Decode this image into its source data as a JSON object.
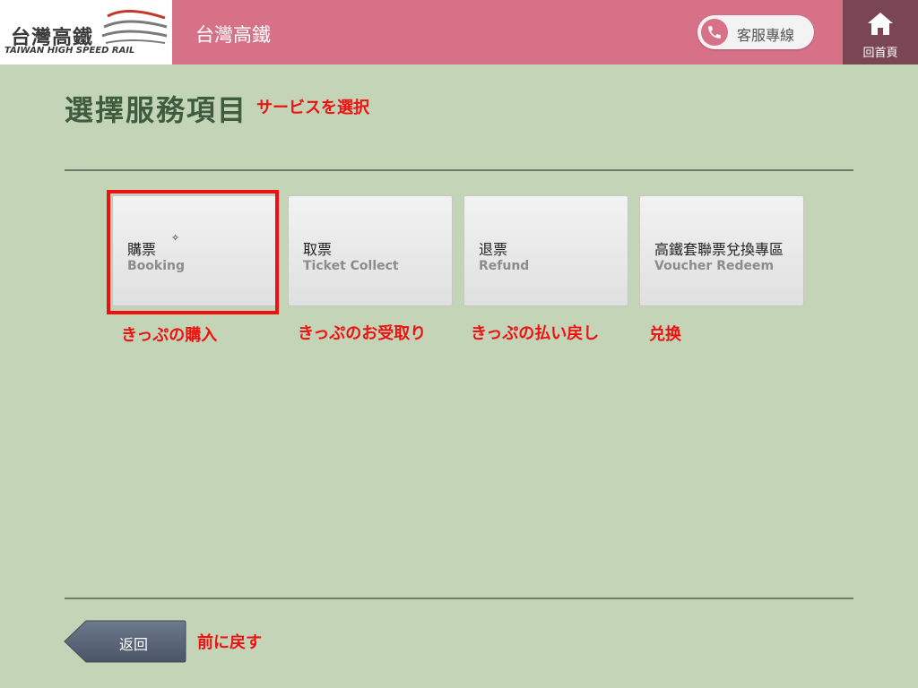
{
  "header": {
    "logo_title": "台灣高鐵",
    "logo_subtitle": "TAIWAN HIGH SPEED RAIL",
    "title": "台灣高鐵",
    "service_label": "客服專線",
    "home_label": "回首頁",
    "colors": {
      "bar": "#d77187",
      "home": "#7a4654"
    }
  },
  "main": {
    "title": "選擇服務項目",
    "title_note": "サービスを選択",
    "tiles": [
      {
        "title": "購票",
        "subtitle": "Booking",
        "note": "きっぷの購入"
      },
      {
        "title": "取票",
        "subtitle": "Ticket Collect",
        "note": "きっぷのお受取り"
      },
      {
        "title": "退票",
        "subtitle": "Refund",
        "note": "きっぷの払い戻し"
      },
      {
        "title": "高鐵套聯票兌換專區",
        "subtitle": "Voucher Redeem",
        "note": "兑换"
      }
    ]
  },
  "footer": {
    "back_label": "返回",
    "back_note": "前に戻す"
  },
  "icons": [
    "phone-icon",
    "home-icon",
    "cursor-icon"
  ],
  "colors": {
    "background": "#c4d4b6",
    "annotation": "#ee1111",
    "heading": "#3f5c3f"
  }
}
